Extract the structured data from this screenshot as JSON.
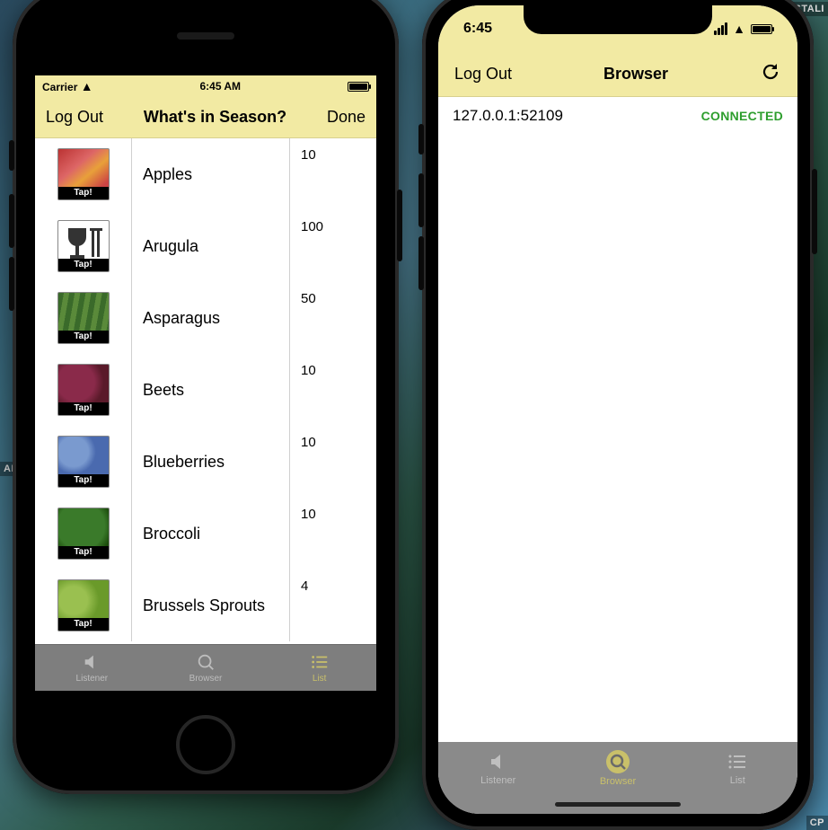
{
  "fragments": {
    "install": "INSTALI",
    "alp": "ALP",
    "cp": "CP"
  },
  "left": {
    "status": {
      "carrier": "Carrier",
      "time": "6:45 AM"
    },
    "nav": {
      "left": "Log Out",
      "title": "What's in Season?",
      "right": "Done"
    },
    "tap_label": "Tap!",
    "items": [
      {
        "name": "Apples",
        "count": "10",
        "img": "t-apples"
      },
      {
        "name": "Arugula",
        "count": "100",
        "img": "t-arugula"
      },
      {
        "name": "Asparagus",
        "count": "50",
        "img": "t-asparagus"
      },
      {
        "name": "Beets",
        "count": "10",
        "img": "t-beets"
      },
      {
        "name": "Blueberries",
        "count": "10",
        "img": "t-blueberries"
      },
      {
        "name": "Broccoli",
        "count": "10",
        "img": "t-broccoli"
      },
      {
        "name": "Brussels Sprouts",
        "count": "4",
        "img": "t-brussels"
      }
    ],
    "tabs": {
      "listener": "Listener",
      "browser": "Browser",
      "list": "List"
    }
  },
  "right": {
    "status": {
      "time": "6:45"
    },
    "nav": {
      "left": "Log Out",
      "title": "Browser"
    },
    "connection": {
      "address": "127.0.0.1:52109",
      "status": "CONNECTED"
    },
    "tabs": {
      "listener": "Listener",
      "browser": "Browser",
      "list": "List"
    }
  }
}
